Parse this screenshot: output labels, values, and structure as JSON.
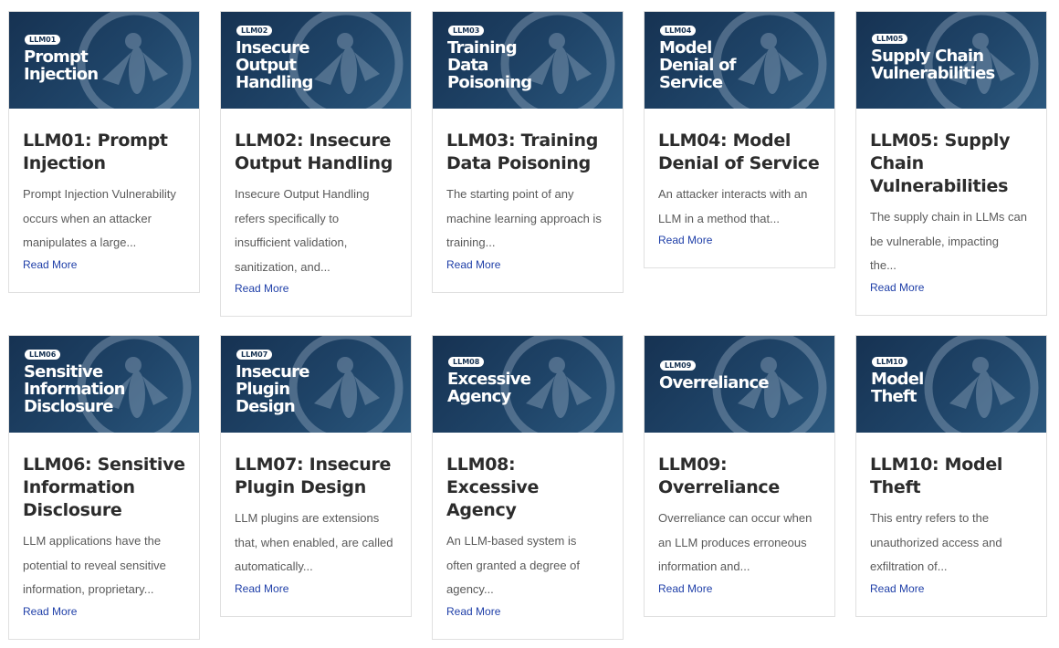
{
  "cards": [
    {
      "badge": "LLM01",
      "thumb_title": "Prompt\nInjection",
      "title": "LLM01: Prompt\nInjection",
      "excerpt": "Prompt Injection Vulnerability\noccurs when an attacker\nmanipulates a large...",
      "read_more": "Read More"
    },
    {
      "badge": "LLM02",
      "thumb_title": "Insecure\nOutput\nHandling",
      "title": "LLM02: Insecure\nOutput Handling",
      "excerpt": "Insecure Output Handling\nrefers specifically to\ninsufficient validation,\nsanitization, and...",
      "read_more": "Read More"
    },
    {
      "badge": "LLM03",
      "thumb_title": "Training\nData\nPoisoning",
      "title": "LLM03: Training\nData Poisoning",
      "excerpt": "The starting point of any\nmachine learning approach is\ntraining...",
      "read_more": "Read More"
    },
    {
      "badge": "LLM04",
      "thumb_title": "Model\nDenial of\nService",
      "title": "LLM04: Model\nDenial of Service",
      "excerpt": "An attacker interacts with an\nLLM in a method that...",
      "read_more": "Read More"
    },
    {
      "badge": "LLM05",
      "thumb_title": "Supply Chain\nVulnerabilities",
      "title": "LLM05: Supply\nChain\nVulnerabilities",
      "excerpt": "The supply chain in LLMs can\nbe vulnerable, impacting\nthe...",
      "read_more": "Read More"
    },
    {
      "badge": "LLM06",
      "thumb_title": "Sensitive\nInformation\nDisclosure",
      "title": "LLM06: Sensitive\nInformation\nDisclosure",
      "excerpt": "LLM applications have the\npotential to reveal sensitive\ninformation, proprietary...",
      "read_more": "Read More"
    },
    {
      "badge": "LLM07",
      "thumb_title": "Insecure\nPlugin\nDesign",
      "title": "LLM07: Insecure\nPlugin Design",
      "excerpt": "LLM plugins are extensions\nthat, when enabled, are called\nautomatically...",
      "read_more": "Read More"
    },
    {
      "badge": "LLM08",
      "thumb_title": "Excessive\nAgency",
      "title": "LLM08: Excessive\nAgency",
      "excerpt": "An LLM-based system is\noften granted a degree of\nagency...",
      "read_more": "Read More"
    },
    {
      "badge": "LLM09",
      "thumb_title": "Overreliance",
      "title": "LLM09:\nOverreliance",
      "excerpt": "Overreliance can occur when\nan LLM produces erroneous\ninformation and...",
      "read_more": "Read More"
    },
    {
      "badge": "LLM10",
      "thumb_title": "Model\nTheft",
      "title": "LLM10: Model Theft",
      "excerpt": "This entry refers to the\nunauthorized access and\nexfiltration of...",
      "read_more": "Read More"
    }
  ]
}
